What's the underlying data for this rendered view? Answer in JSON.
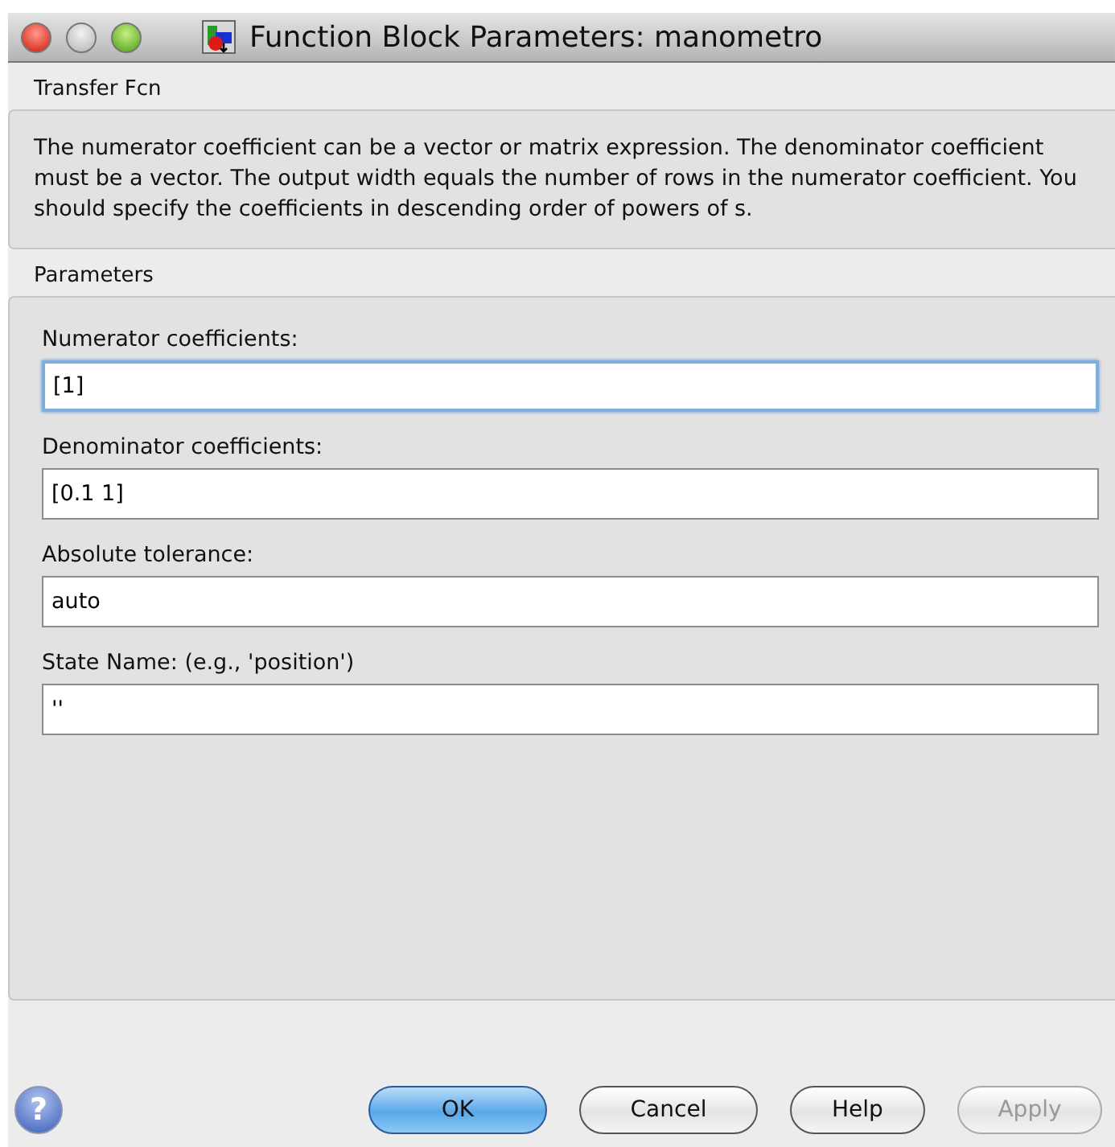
{
  "window": {
    "title": "Function Block Parameters: manometro"
  },
  "description": {
    "heading": "Transfer Fcn",
    "text": "The numerator coefficient can be a vector or matrix expression. The denominator coefficient must be a vector. The output width equals the number of rows in the numerator coefficient. You should specify the coefficients in descending order of powers of s."
  },
  "parameters": {
    "heading": "Parameters",
    "fields": [
      {
        "label": "Numerator coefficients:",
        "value": "[1]",
        "focused": true
      },
      {
        "label": "Denominator coefficients:",
        "value": "[0.1 1]",
        "focused": false
      },
      {
        "label": "Absolute tolerance:",
        "value": "auto",
        "focused": false
      },
      {
        "label": "State Name: (e.g., 'position')",
        "value": "''",
        "focused": false
      }
    ]
  },
  "help_icon": "?",
  "buttons": [
    {
      "label": "OK",
      "kind": "default",
      "disabled": false
    },
    {
      "label": "Cancel",
      "kind": "normal",
      "disabled": false
    },
    {
      "label": "Help",
      "kind": "normal",
      "disabled": false
    },
    {
      "label": "Apply",
      "kind": "normal",
      "disabled": true
    }
  ]
}
